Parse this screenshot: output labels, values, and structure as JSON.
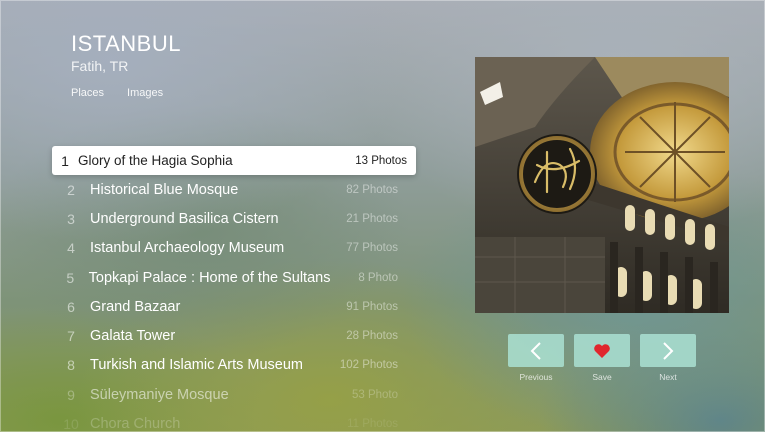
{
  "header": {
    "city": "ISTANBUL",
    "location": "Fatih, TR",
    "tabs": [
      "Places",
      "Images"
    ]
  },
  "places": [
    {
      "num": "1",
      "title": "Glory of the Hagia Sophia",
      "count": "13 Photos",
      "selected": true
    },
    {
      "num": "2",
      "title": "Historical Blue Mosque",
      "count": "82 Photos"
    },
    {
      "num": "3",
      "title": "Underground Basilica Cistern",
      "count": "21 Photos"
    },
    {
      "num": "4",
      "title": "Istanbul Archaeology Museum",
      "count": "77 Photos"
    },
    {
      "num": "5",
      "title": "Topkapi Palace : Home of the Sultans",
      "count": "8 Photo"
    },
    {
      "num": "6",
      "title": "Grand Bazaar",
      "count": "91 Photos"
    },
    {
      "num": "7",
      "title": "Galata Tower",
      "count": "28 Photos"
    },
    {
      "num": "8",
      "title": "Turkish and Islamic Arts Museum",
      "count": "102 Photos"
    },
    {
      "num": "9",
      "title": "Süleymaniye Mosque",
      "count": "53 Photo"
    },
    {
      "num": "10",
      "title": "Chora Church",
      "count": "11 Photos"
    }
  ],
  "controls": {
    "previous_label": "Previous",
    "save_label": "Save",
    "next_label": "Next"
  },
  "colors": {
    "heart": "#e0262d",
    "button_bg": "#aae1d2"
  },
  "icons": {
    "previous": "chevron-left-icon",
    "save": "heart-icon",
    "next": "chevron-right-icon"
  }
}
